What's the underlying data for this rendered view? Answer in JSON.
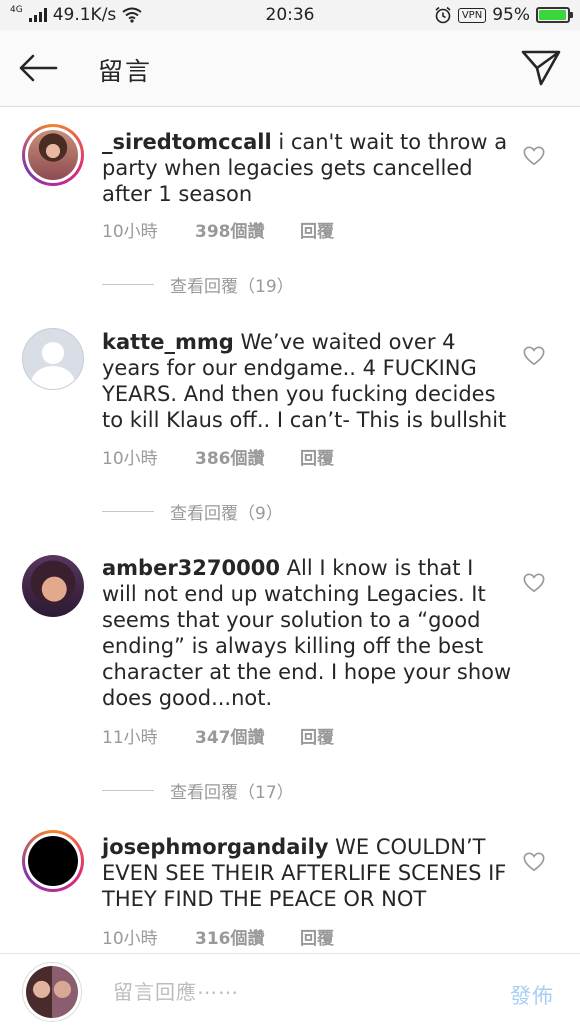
{
  "status_bar": {
    "network_type": "4G",
    "speed": "49.1K/s",
    "time": "20:36",
    "vpn": "VPN",
    "battery_percent": "95%",
    "battery_level": 0.95
  },
  "header": {
    "title": "留言"
  },
  "comments": [
    {
      "username": "_siredtomccall",
      "body": "i can't wait to throw a party when legacies gets cancelled after 1 season",
      "time": "10小時",
      "likes": "398個讚",
      "reply": "回覆",
      "view_replies": "查看回覆（19）"
    },
    {
      "username": "katte_mmg",
      "body": "We’ve waited over 4 years for our endgame.. 4 FUCKING YEARS. And then you fucking decides to kill Klaus off.. I can’t- This is bullshit",
      "time": "10小時",
      "likes": "386個讚",
      "reply": "回覆",
      "view_replies": "查看回覆（9）"
    },
    {
      "username": "amber3270000",
      "body": "All I know is that I will not end up watching Legacies. It seems that your solution to a “good ending” is always killing off the best character at the end. I hope your show does good...not.",
      "time": "11小時",
      "likes": "347個讚",
      "reply": "回覆",
      "view_replies": "查看回覆（17）"
    },
    {
      "username": "josephmorgandaily",
      "body": "WE COULDN’T EVEN SEE THEIR AFTERLIFE SCENES IF THEY FIND THE PEACE OR NOT",
      "time": "10小時",
      "likes": "316個讚",
      "reply": "回覆"
    }
  ],
  "footer": {
    "placeholder": "留言回應⋯⋯",
    "post_label": "發佈",
    "post_color": "#a7cff5"
  },
  "icons": {
    "back": "arrow-left-icon",
    "send": "paper-plane-icon",
    "like": "heart-icon",
    "wifi": "wifi-icon",
    "alarm": "alarm-clock-icon",
    "signal": "signal-bars-icon"
  }
}
